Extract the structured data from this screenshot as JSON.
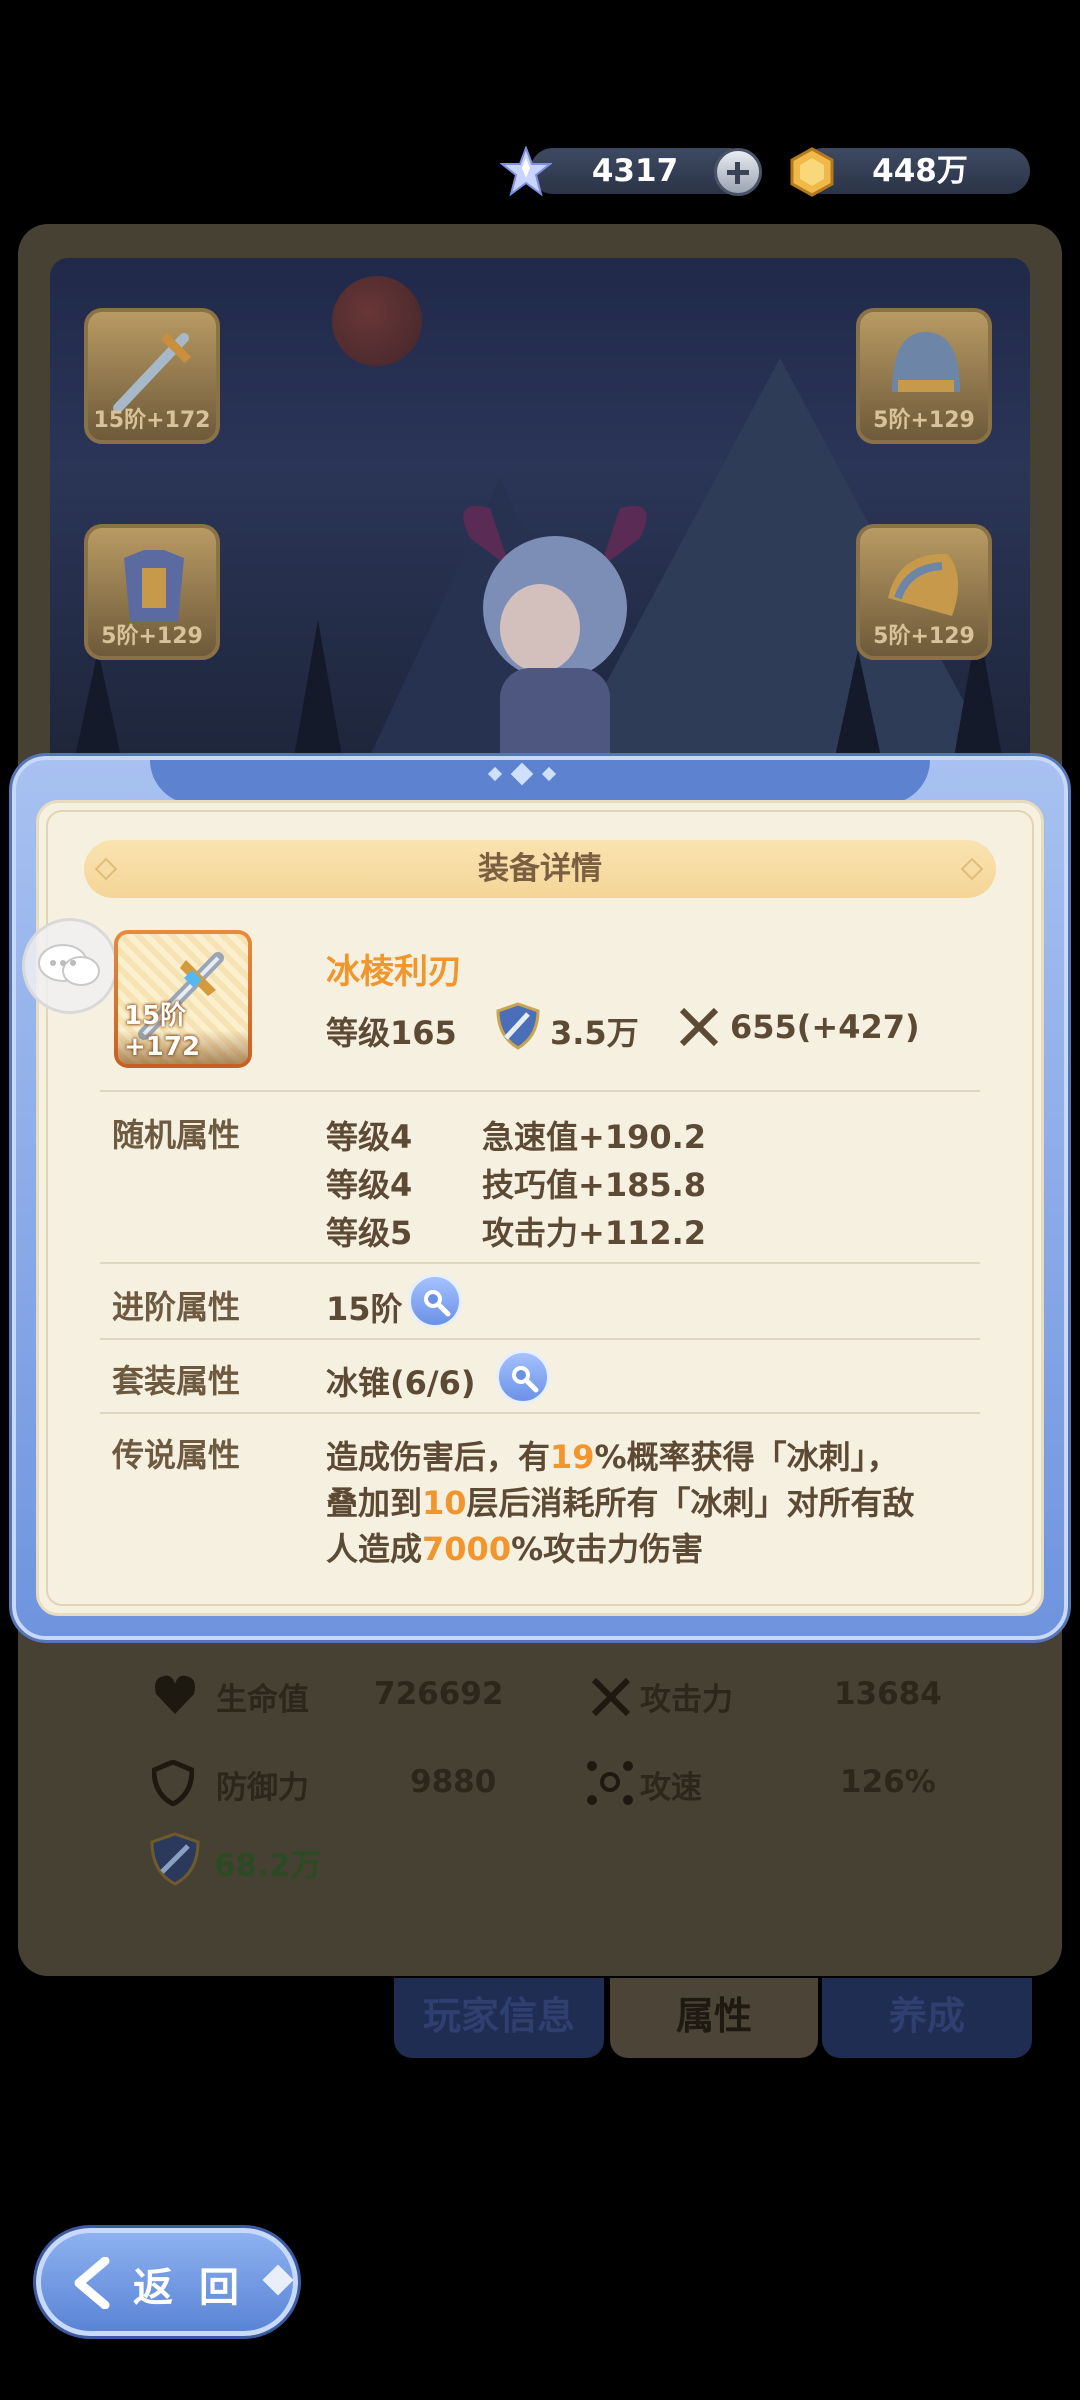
{
  "currency": {
    "gems": "4317",
    "gold": "448万"
  },
  "background_slots": {
    "weapon_label": "15阶+172",
    "helmet_label": "5阶+129",
    "armor_label": "5阶+129",
    "shoulder_label": "5阶+129"
  },
  "hero_stats": {
    "hp_label": "生命值",
    "hp_value": "726692",
    "atk_label": "攻击力",
    "atk_value": "13684",
    "def_label": "防御力",
    "def_value": "9880",
    "speed_label": "攻速",
    "speed_value": "126%",
    "power_value": "68.2万"
  },
  "bottom_tabs": [
    "玩家信息",
    "属性",
    "养成"
  ],
  "back_button": "返回",
  "modal": {
    "title": "装备详情",
    "item": {
      "badge": "15阶+172",
      "name": "冰棱利刃",
      "level": "等级165",
      "power": "3.5万",
      "attack": "655(+427)"
    },
    "random_attrs": {
      "label": "随机属性",
      "rows": [
        {
          "level": "等级4",
          "stat": "急速值+190.2"
        },
        {
          "level": "等级4",
          "stat": "技巧值+185.8"
        },
        {
          "level": "等级5",
          "stat": "攻击力+112.2"
        }
      ]
    },
    "advance_attrs": {
      "label": "进阶属性",
      "value": "15阶"
    },
    "set_attrs": {
      "label": "套装属性",
      "value": "冰锥(6/6)"
    },
    "legend_attrs": {
      "label": "传说属性",
      "line1_a": "造成伤害后，有",
      "line1_hl": "19",
      "line1_b": "%概率获得「冰刺」，",
      "line2_a": "叠加到",
      "line2_hl": "10",
      "line2_b": "层后消耗所有「冰刺」对所有敌",
      "line3_a": "人造成",
      "line3_hl": "7000",
      "line3_b": "%攻击力伤害"
    }
  },
  "colors": {
    "accent_orange": "#f0962d",
    "modal_blue": "#6f94de",
    "parchment": "#f6f0e0"
  }
}
